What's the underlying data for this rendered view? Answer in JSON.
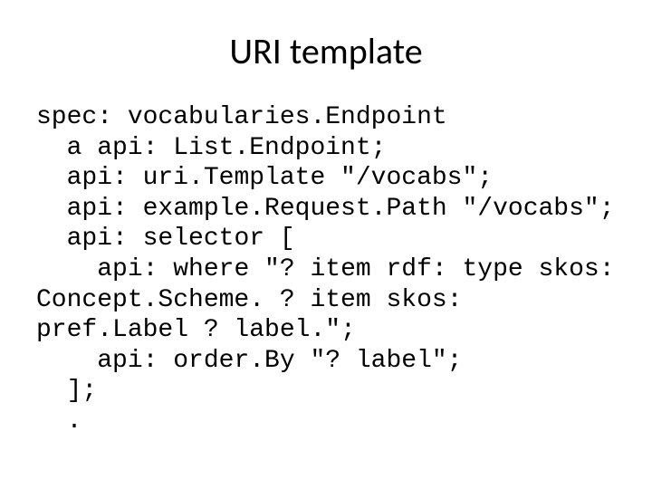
{
  "title": "URI template",
  "code": "spec: vocabularies.Endpoint\n  a api: List.Endpoint;\n  api: uri.Template \"/vocabs\";\n  api: example.Request.Path \"/vocabs\";\n  api: selector [\n    api: where \"? item rdf: type skos: Concept.Scheme. ? item skos: pref.Label ? label.\";\n    api: order.By \"? label\";\n  ];\n  ."
}
